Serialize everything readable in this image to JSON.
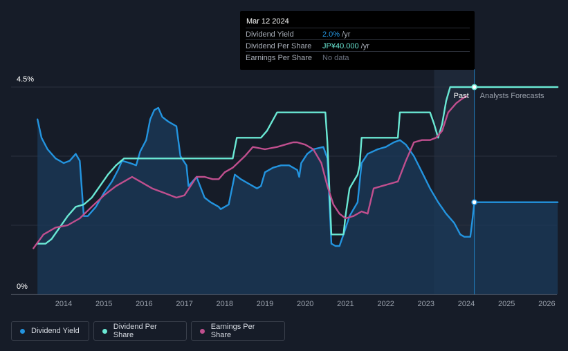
{
  "tooltip": {
    "date": "Mar 12 2024",
    "rows": [
      {
        "label": "Dividend Yield",
        "value": "2.0%",
        "unit": " /yr",
        "color": "#2394df"
      },
      {
        "label": "Dividend Per Share",
        "value": "JP¥40.000",
        "unit": " /yr",
        "color": "#6ae8d4"
      },
      {
        "label": "Earnings Per Share",
        "value": "No data",
        "unit": "",
        "color": "#6b7280"
      }
    ]
  },
  "legend": [
    {
      "label": "Dividend Yield",
      "color": "#2394df"
    },
    {
      "label": "Dividend Per Share",
      "color": "#6ae8d4"
    },
    {
      "label": "Earnings Per Share",
      "color": "#c04f8e"
    }
  ],
  "chart_data": {
    "type": "line",
    "x_ticks": [
      "2014",
      "2015",
      "2016",
      "2017",
      "2018",
      "2019",
      "2020",
      "2021",
      "2022",
      "2023",
      "2024",
      "2025",
      "2026"
    ],
    "y_ticks": [
      "4.5%",
      "0%"
    ],
    "ylim": [
      0,
      4.5
    ],
    "xlim": [
      2013.0,
      2026.27
    ],
    "past_label": "Past",
    "forecast_label": "Analysts Forecasts",
    "forecast_start": 2024.2,
    "highlight_start": 2023.2,
    "series": [
      {
        "name": "Dividend Yield",
        "color": "#2394df",
        "points": [
          [
            2013.35,
            3.8
          ],
          [
            2013.45,
            3.4
          ],
          [
            2013.6,
            3.15
          ],
          [
            2013.8,
            2.95
          ],
          [
            2014.0,
            2.85
          ],
          [
            2014.15,
            2.9
          ],
          [
            2014.3,
            3.05
          ],
          [
            2014.4,
            2.9
          ],
          [
            2014.5,
            1.7
          ],
          [
            2014.6,
            1.7
          ],
          [
            2014.8,
            1.9
          ],
          [
            2015.0,
            2.2
          ],
          [
            2015.2,
            2.45
          ],
          [
            2015.35,
            2.7
          ],
          [
            2015.45,
            2.9
          ],
          [
            2015.65,
            2.85
          ],
          [
            2015.8,
            2.8
          ],
          [
            2015.9,
            3.1
          ],
          [
            2016.05,
            3.35
          ],
          [
            2016.15,
            3.8
          ],
          [
            2016.25,
            4.0
          ],
          [
            2016.35,
            4.05
          ],
          [
            2016.45,
            3.85
          ],
          [
            2016.6,
            3.75
          ],
          [
            2016.8,
            3.65
          ],
          [
            2016.9,
            3.0
          ],
          [
            2017.05,
            2.8
          ],
          [
            2017.1,
            2.35
          ],
          [
            2017.3,
            2.55
          ],
          [
            2017.5,
            2.1
          ],
          [
            2017.65,
            2.0
          ],
          [
            2017.85,
            1.9
          ],
          [
            2017.9,
            1.85
          ],
          [
            2018.1,
            1.95
          ],
          [
            2018.25,
            2.6
          ],
          [
            2018.4,
            2.5
          ],
          [
            2018.6,
            2.4
          ],
          [
            2018.8,
            2.3
          ],
          [
            2018.9,
            2.35
          ],
          [
            2019.0,
            2.65
          ],
          [
            2019.2,
            2.75
          ],
          [
            2019.4,
            2.8
          ],
          [
            2019.6,
            2.8
          ],
          [
            2019.8,
            2.7
          ],
          [
            2019.85,
            2.55
          ],
          [
            2019.9,
            2.85
          ],
          [
            2020.05,
            3.05
          ],
          [
            2020.2,
            3.15
          ],
          [
            2020.45,
            3.2
          ],
          [
            2020.55,
            2.95
          ],
          [
            2020.65,
            1.1
          ],
          [
            2020.75,
            1.05
          ],
          [
            2020.85,
            1.05
          ],
          [
            2020.95,
            1.3
          ],
          [
            2021.1,
            1.7
          ],
          [
            2021.3,
            2.0
          ],
          [
            2021.4,
            2.85
          ],
          [
            2021.55,
            3.05
          ],
          [
            2021.8,
            3.15
          ],
          [
            2022.0,
            3.2
          ],
          [
            2022.2,
            3.3
          ],
          [
            2022.35,
            3.35
          ],
          [
            2022.5,
            3.25
          ],
          [
            2022.7,
            3.0
          ],
          [
            2022.9,
            2.65
          ],
          [
            2023.1,
            2.3
          ],
          [
            2023.3,
            2.0
          ],
          [
            2023.5,
            1.75
          ],
          [
            2023.7,
            1.55
          ],
          [
            2023.85,
            1.3
          ],
          [
            2023.95,
            1.25
          ],
          [
            2024.1,
            1.25
          ],
          [
            2024.15,
            1.6
          ],
          [
            2024.2,
            2.0
          ],
          [
            2026.27,
            2.0
          ]
        ]
      },
      {
        "name": "Dividend Per Share",
        "color": "#6ae8d4",
        "points": [
          [
            2013.35,
            1.1
          ],
          [
            2013.55,
            1.1
          ],
          [
            2013.7,
            1.2
          ],
          [
            2013.9,
            1.45
          ],
          [
            2014.1,
            1.7
          ],
          [
            2014.3,
            1.9
          ],
          [
            2014.5,
            1.95
          ],
          [
            2014.7,
            2.1
          ],
          [
            2014.9,
            2.35
          ],
          [
            2015.1,
            2.6
          ],
          [
            2015.3,
            2.8
          ],
          [
            2015.5,
            2.95
          ],
          [
            2015.8,
            2.95
          ],
          [
            2016.2,
            2.95
          ],
          [
            2016.8,
            2.95
          ],
          [
            2017.2,
            2.95
          ],
          [
            2017.8,
            2.95
          ],
          [
            2018.1,
            2.95
          ],
          [
            2018.2,
            2.95
          ],
          [
            2018.3,
            3.4
          ],
          [
            2018.9,
            3.4
          ],
          [
            2019.05,
            3.55
          ],
          [
            2019.3,
            3.95
          ],
          [
            2019.8,
            3.95
          ],
          [
            2020.3,
            3.95
          ],
          [
            2020.5,
            3.95
          ],
          [
            2020.55,
            3.3
          ],
          [
            2020.65,
            1.3
          ],
          [
            2020.95,
            1.3
          ],
          [
            2021.0,
            1.7
          ],
          [
            2021.1,
            2.3
          ],
          [
            2021.3,
            2.6
          ],
          [
            2021.35,
            2.8
          ],
          [
            2021.4,
            3.4
          ],
          [
            2021.9,
            3.4
          ],
          [
            2022.3,
            3.4
          ],
          [
            2022.35,
            3.95
          ],
          [
            2022.8,
            3.95
          ],
          [
            2023.1,
            3.95
          ],
          [
            2023.2,
            3.7
          ],
          [
            2023.3,
            3.4
          ],
          [
            2023.4,
            3.7
          ],
          [
            2023.5,
            4.2
          ],
          [
            2023.6,
            4.5
          ],
          [
            2023.8,
            4.5
          ],
          [
            2024.2,
            4.5
          ],
          [
            2026.27,
            4.5
          ]
        ]
      },
      {
        "name": "Earnings Per Share",
        "color": "#c04f8e",
        "points": [
          [
            2013.25,
            1.0
          ],
          [
            2013.5,
            1.3
          ],
          [
            2013.8,
            1.45
          ],
          [
            2014.1,
            1.5
          ],
          [
            2014.4,
            1.65
          ],
          [
            2014.7,
            1.9
          ],
          [
            2015.0,
            2.15
          ],
          [
            2015.3,
            2.35
          ],
          [
            2015.5,
            2.45
          ],
          [
            2015.7,
            2.55
          ],
          [
            2015.9,
            2.45
          ],
          [
            2016.2,
            2.3
          ],
          [
            2016.5,
            2.2
          ],
          [
            2016.8,
            2.1
          ],
          [
            2017.0,
            2.15
          ],
          [
            2017.3,
            2.55
          ],
          [
            2017.5,
            2.55
          ],
          [
            2017.7,
            2.5
          ],
          [
            2017.85,
            2.5
          ],
          [
            2018.0,
            2.65
          ],
          [
            2018.2,
            2.75
          ],
          [
            2018.5,
            3.0
          ],
          [
            2018.7,
            3.2
          ],
          [
            2019.0,
            3.15
          ],
          [
            2019.3,
            3.2
          ],
          [
            2019.5,
            3.25
          ],
          [
            2019.7,
            3.3
          ],
          [
            2019.8,
            3.3
          ],
          [
            2020.0,
            3.25
          ],
          [
            2020.2,
            3.15
          ],
          [
            2020.4,
            2.85
          ],
          [
            2020.55,
            2.35
          ],
          [
            2020.7,
            1.95
          ],
          [
            2020.85,
            1.75
          ],
          [
            2021.0,
            1.65
          ],
          [
            2021.2,
            1.7
          ],
          [
            2021.4,
            1.8
          ],
          [
            2021.55,
            1.75
          ],
          [
            2021.7,
            2.3
          ],
          [
            2021.9,
            2.35
          ],
          [
            2022.1,
            2.4
          ],
          [
            2022.3,
            2.45
          ],
          [
            2022.5,
            2.9
          ],
          [
            2022.7,
            3.3
          ],
          [
            2022.9,
            3.35
          ],
          [
            2023.1,
            3.35
          ],
          [
            2023.25,
            3.4
          ],
          [
            2023.4,
            3.55
          ],
          [
            2023.55,
            3.95
          ],
          [
            2023.75,
            4.15
          ],
          [
            2023.9,
            4.25
          ],
          [
            2024.0,
            4.3
          ]
        ]
      }
    ]
  }
}
